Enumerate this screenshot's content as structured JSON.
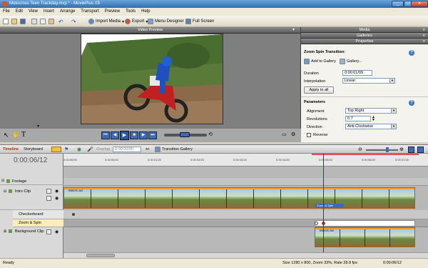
{
  "window": {
    "title": "Motocross Teen Trackday.mvp * - MoviePlus X5",
    "minimize": "_",
    "maximize": "□",
    "close": "✕"
  },
  "menu": [
    "File",
    "Edit",
    "View",
    "Insert",
    "Arrange",
    "Transport",
    "Preview",
    "Tools",
    "Help"
  ],
  "toolbar": {
    "import_media": "Import Media",
    "export": "Export",
    "menu_designer": "Menu Designer",
    "full_screen": "Full Screen"
  },
  "preview": {
    "header": "Video Preview"
  },
  "right_panel": {
    "tabs": [
      "Media",
      "Galleries",
      "Properties"
    ],
    "transition_title": "Zoom Spin Transition:",
    "add_to_gallery": "Add to Gallery",
    "gallery": "Gallery...",
    "duration_label": "Duration",
    "duration_value": "0:00:01/09",
    "interpolation_label": "Interpolation",
    "interpolation_value": "Linear",
    "apply_all": "Apply to all",
    "parameters_header": "Parameters",
    "alignment_label": "Alignment",
    "alignment_value": "Top Right",
    "revolutions_label": "Revolutions",
    "revolutions_value": "0.7",
    "direction_label": "Direction",
    "direction_value": "Anti-Clockwise",
    "reverse_label": "Reverse"
  },
  "timeline": {
    "tab_timeline": "Timeline",
    "tab_storyboard": "Storyboard",
    "overlap_label": "Overlap",
    "overlap_value": "0:00:00/00",
    "transition_gallery": "Transition Gallery",
    "timecode": "0:00:06/12",
    "ruler_ticks": [
      "0:00:00/00",
      "0:00:00/20",
      "0:00:01/20",
      "0:00:02/20",
      "0:00:03/20",
      "0:00:04/20",
      "0:00:05/20",
      "0:00:06/20",
      "0:00:07/20"
    ],
    "tracks": {
      "footage": "Footage",
      "intro_clip": "Intro Clip",
      "checkerboard": "Checkerboard",
      "zoom_spin": "Zoom & Spin",
      "background_clip": "Background Clip"
    },
    "intro_clip_name": "MotoX.avi",
    "transition_bar_label": "Zoom & Spin",
    "bg_clip_name": "MotoX.avi"
  },
  "status": {
    "ready": "Ready",
    "info": "Size 1280 x 800, Zoom 33%, Rate 28.8 fps",
    "time": "0:00:06/12"
  },
  "colors": {
    "title_bar": "#2f6fb0",
    "accent_orange": "#f0a030",
    "playhead": "#3030c0"
  }
}
